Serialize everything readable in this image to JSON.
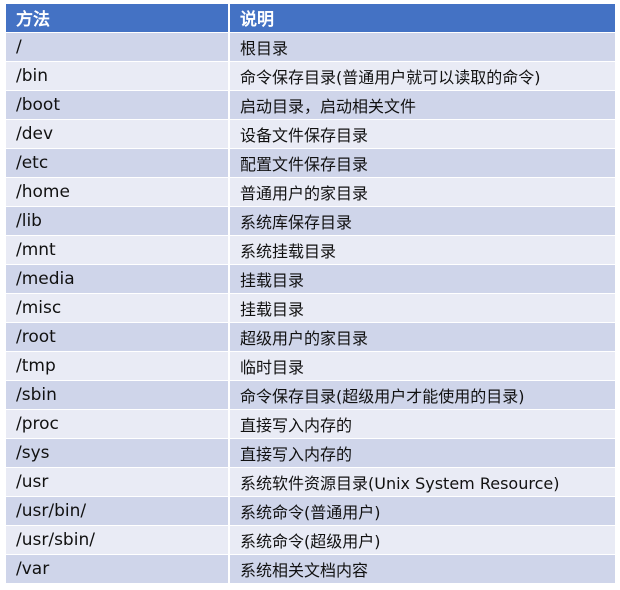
{
  "table": {
    "headers": [
      "方法",
      "说明"
    ],
    "rows": [
      [
        "/",
        "根目录"
      ],
      [
        "/bin",
        "命令保存目录(普通用户就可以读取的命令)"
      ],
      [
        "/boot",
        "启动目录，启动相关文件"
      ],
      [
        "/dev",
        "设备文件保存目录"
      ],
      [
        "/etc",
        "配置文件保存目录"
      ],
      [
        "/home",
        "普通用户的家目录"
      ],
      [
        "/lib",
        "系统库保存目录"
      ],
      [
        "/mnt",
        "系统挂载目录"
      ],
      [
        "/media",
        "挂载目录"
      ],
      [
        "/misc",
        "挂载目录"
      ],
      [
        "/root",
        "超级用户的家目录"
      ],
      [
        "/tmp",
        "临时目录"
      ],
      [
        "/sbin",
        " 命令保存目录(超级用户才能使用的目录)"
      ],
      [
        "/proc",
        " 直接写入内存的"
      ],
      [
        "/sys",
        "直接写入内存的"
      ],
      [
        "/usr",
        "系统软件资源目录(Unix System Resource)"
      ],
      [
        "/usr/bin/",
        "系统命令(普通用户)"
      ],
      [
        "/usr/sbin/",
        "系统命令(超级用户)"
      ],
      [
        "/var",
        "系统相关文档内容"
      ]
    ]
  },
  "colors": {
    "header_bg": "#4472c4",
    "row_dark": "#cfd5ea",
    "row_light": "#e9ebf5"
  }
}
